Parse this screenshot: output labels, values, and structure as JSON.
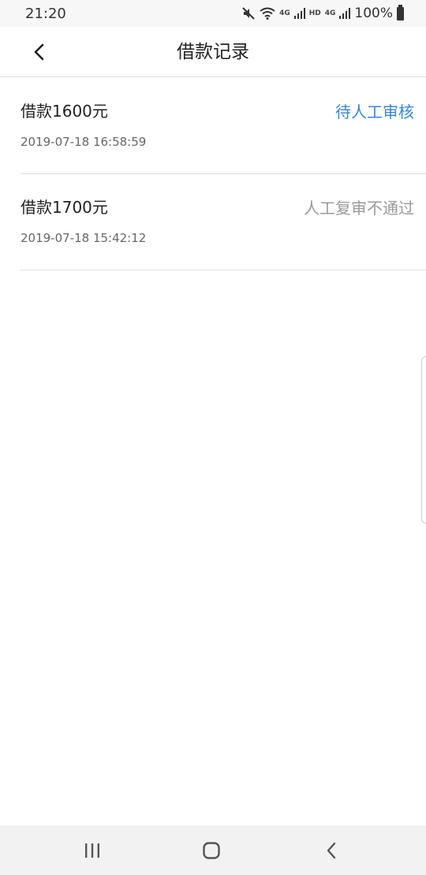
{
  "status_bar": {
    "time": "21:20",
    "net1": "4G",
    "hd": "HD",
    "net2": "4G",
    "battery": "100%",
    "icons": [
      "mute-icon",
      "wifi-icon",
      "signal-icon",
      "battery-icon"
    ]
  },
  "header": {
    "title": "借款记录",
    "back_icon": "chevron-left-icon"
  },
  "records": [
    {
      "amount": "借款1600元",
      "time": "2019-07-18 16:58:59",
      "status": "待人工审核",
      "status_color": "#3a86d8"
    },
    {
      "amount": "借款1700元",
      "time": "2019-07-18 15:42:12",
      "status": "人工复审不通过",
      "status_color": "#9a9a9a"
    }
  ],
  "nav_bar": {
    "buttons": [
      "recents-icon",
      "home-icon",
      "back-icon"
    ]
  }
}
